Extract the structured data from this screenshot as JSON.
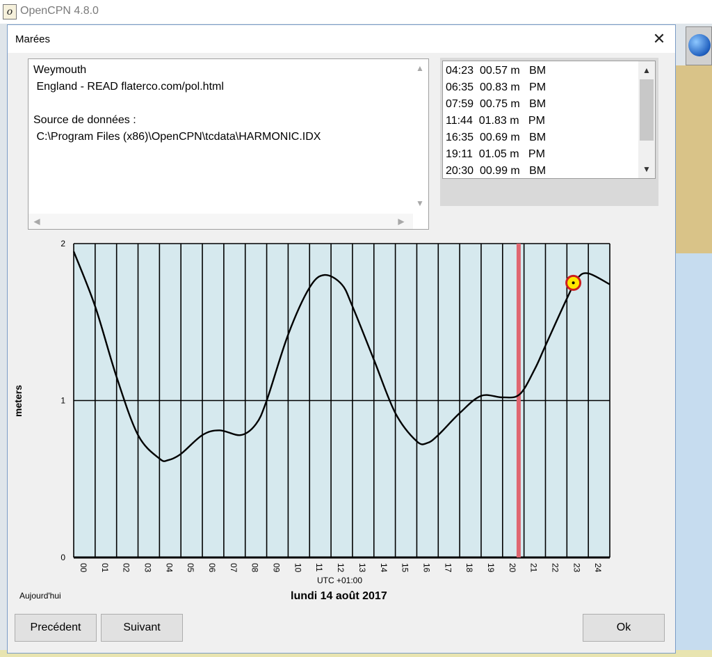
{
  "app": {
    "title": "OpenCPN 4.8.0"
  },
  "dialog": {
    "title": "Marées",
    "close_symbol": "✕",
    "station_info": {
      "station": "Weymouth",
      "region": " England - READ flaterco.com/pol.html",
      "source_label": "Source de données :",
      "source_path": " C:\\Program Files (x86)\\OpenCPN\\tcdata\\HARMONIC.IDX"
    },
    "tide_events": [
      {
        "time": "04:23",
        "height": "00.57 m",
        "type": "BM"
      },
      {
        "time": "06:35",
        "height": "00.83 m",
        "type": "PM"
      },
      {
        "time": "07:59",
        "height": "00.75 m",
        "type": "BM"
      },
      {
        "time": "11:44",
        "height": "01.83 m",
        "type": "PM"
      },
      {
        "time": "16:35",
        "height": "00.69 m",
        "type": "BM"
      },
      {
        "time": "19:11",
        "height": "01.05 m",
        "type": "PM"
      },
      {
        "time": "20:30",
        "height": "00.99 m",
        "type": "BM"
      }
    ],
    "timezone_label": "UTC +01:00",
    "today_label": "Aujourd'hui",
    "date_label": "lundi 14 août 2017",
    "buttons": {
      "previous": "Precédent",
      "next": "Suivant",
      "ok": "Ok"
    }
  },
  "chart_data": {
    "type": "line",
    "ylabel": "meters",
    "xlabel": "UTC +01:00",
    "xlim": [
      0,
      25
    ],
    "ylim": [
      0,
      2
    ],
    "y_ticks": [
      "0",
      "1",
      "2"
    ],
    "x_ticks": [
      "00",
      "01",
      "02",
      "03",
      "04",
      "05",
      "06",
      "07",
      "08",
      "09",
      "10",
      "11",
      "12",
      "13",
      "14",
      "15",
      "16",
      "17",
      "18",
      "19",
      "20",
      "21",
      "22",
      "23",
      "24"
    ],
    "series": [
      {
        "x": [
          0,
          1,
          2,
          3,
          4,
          4.4,
          5,
          6,
          6.8,
          7.8,
          8.5,
          9,
          10,
          11,
          11.7,
          12.5,
          13,
          14,
          15,
          16,
          16.5,
          17,
          18,
          19,
          20,
          20.8,
          21.5,
          22,
          23,
          23.5,
          24,
          25
        ],
        "values": [
          1.95,
          1.6,
          1.15,
          0.78,
          0.63,
          0.62,
          0.66,
          0.78,
          0.81,
          0.78,
          0.85,
          1.0,
          1.42,
          1.72,
          1.8,
          1.74,
          1.6,
          1.26,
          0.92,
          0.74,
          0.73,
          0.78,
          0.92,
          1.03,
          1.02,
          1.04,
          1.2,
          1.35,
          1.65,
          1.78,
          1.81,
          1.74
        ]
      }
    ],
    "current_time": 20.75,
    "current_marker": {
      "x": 23.3,
      "y": 1.75
    },
    "grid": true,
    "colors": {
      "background": "#d6e9ee",
      "line": "#000000",
      "current_time_line": "#e06670",
      "marker_fill": "#ffe800",
      "marker_ring": "#cc1f1f"
    }
  }
}
